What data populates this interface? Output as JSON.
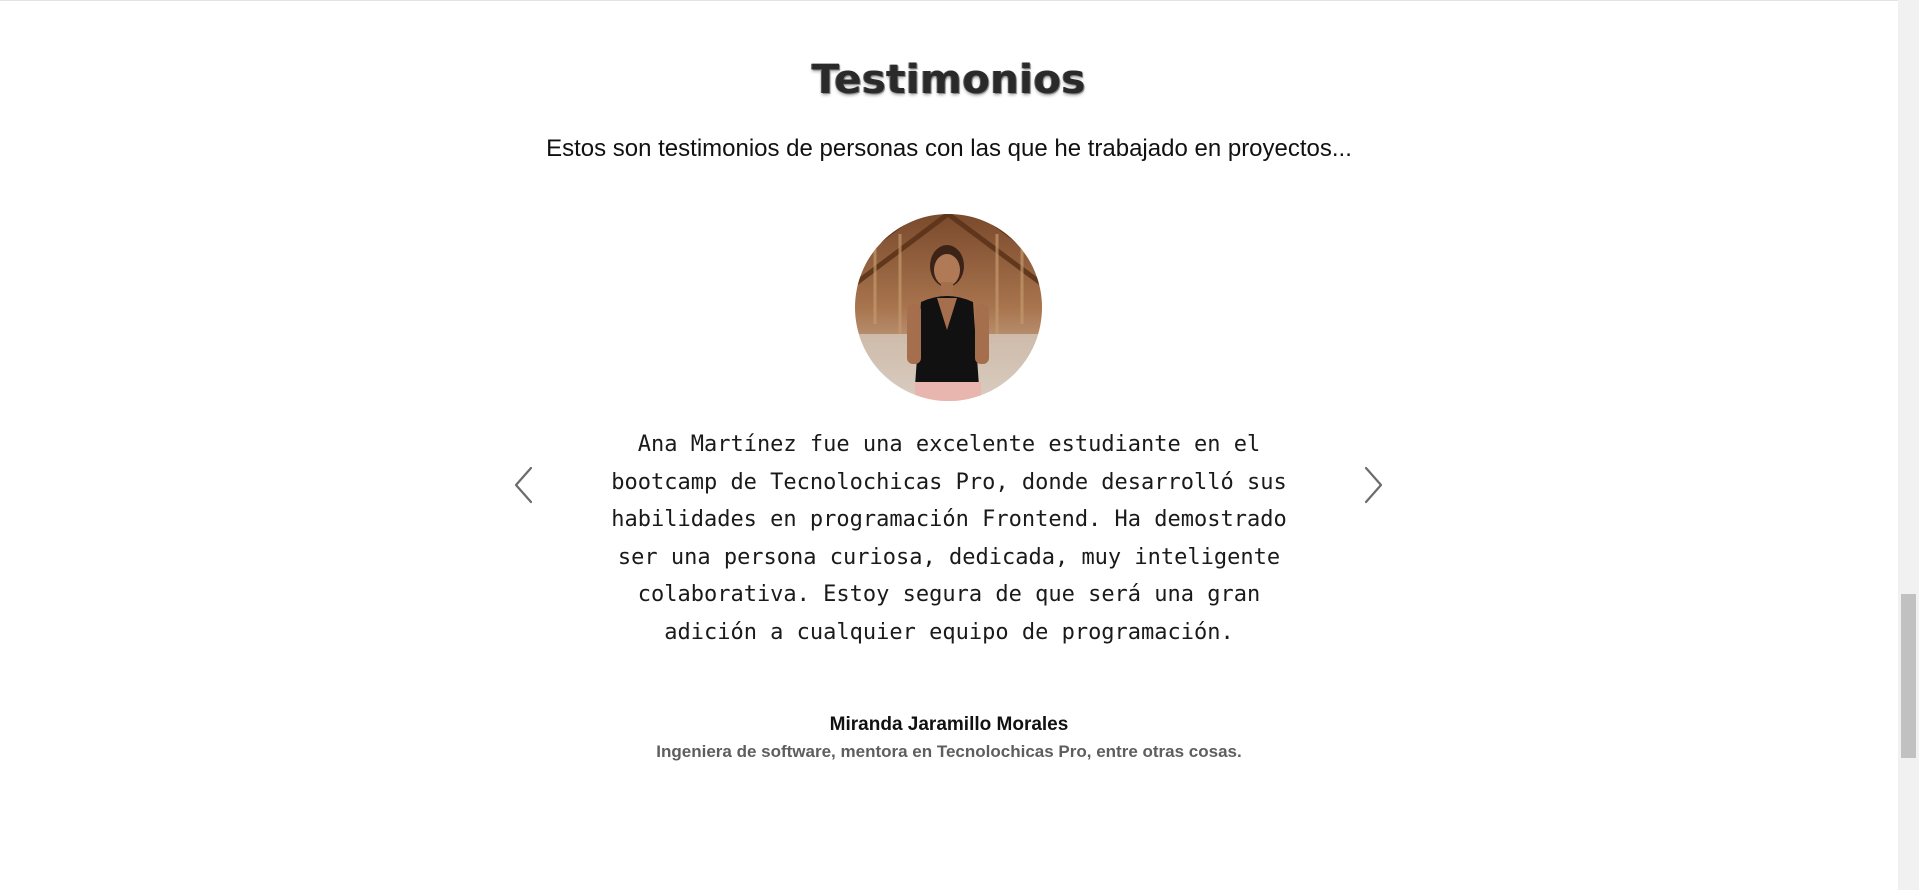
{
  "testimonials": {
    "title": "Testimonios",
    "subtitle": "Estos son testimonios de personas con las que he trabajado en proyectos...",
    "current": {
      "quote": "Ana Martínez fue una excelente estudiante en el bootcamp de Tecnolochicas Pro, donde desarrolló sus habilidades en programación Frontend. Ha demostrado ser una persona curiosa, dedicada, muy inteligente colaborativa. Estoy segura de que será una gran adición a cualquier equipo de programación.",
      "author": "Miranda Jaramillo Morales",
      "role": "Ingeniera de software, mentora en Tecnolochicas Pro, entre otras cosas."
    },
    "prev_icon": "chevron-left-icon",
    "next_icon": "chevron-right-icon"
  },
  "colors": {
    "background": "#ffffff",
    "text": "#111111",
    "muted": "#5e5e5e",
    "arrow": "#6b6b6b"
  }
}
